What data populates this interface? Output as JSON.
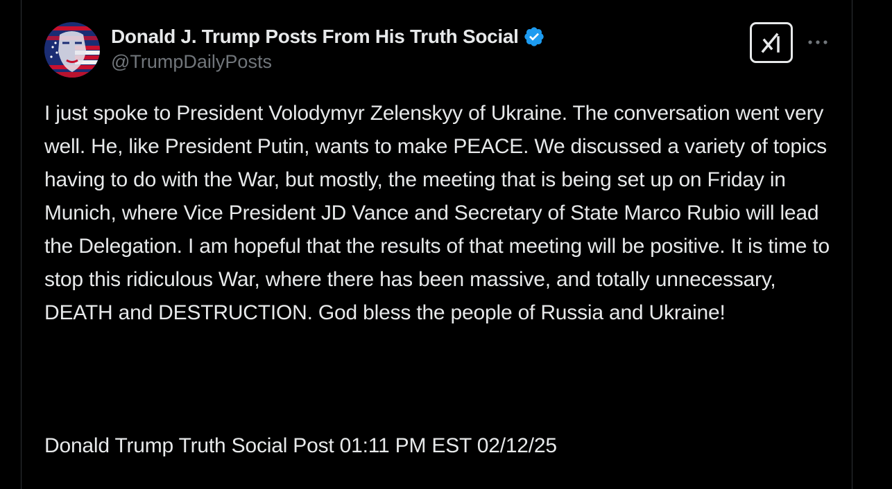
{
  "author": {
    "display_name": "Donald J. Trump Posts From His Truth Social",
    "handle": "@TrumpDailyPosts",
    "avatar_icon": "flag-face-avatar",
    "verified_icon": "verified-badge-icon",
    "verified_color": "#1d9bf0"
  },
  "header": {
    "grok_icon": "grok-icon",
    "more_icon": "more-options-icon"
  },
  "post": {
    "text": "I just spoke to President Volodymyr Zelenskyy of Ukraine. The conversation went very well. He, like President Putin, wants to make PEACE. We discussed a variety of topics having to do with the War, but mostly, the meeting that is being set up on Friday in Munich, where Vice President JD Vance and Secretary of State Marco Rubio will lead the Delegation. I am hopeful that the results of that meeting will be positive. It is time to stop this ridiculous War, where there has been massive, and totally unnecessary, DEATH and DESTRUCTION. God bless the people of Russia and Ukraine!",
    "footer": "Donald Trump Truth Social Post 01:11 PM EST 02/12/25"
  },
  "colors": {
    "background": "#000000",
    "text_primary": "#e7e9ea",
    "text_secondary": "#71767b",
    "border": "#2f3336"
  }
}
